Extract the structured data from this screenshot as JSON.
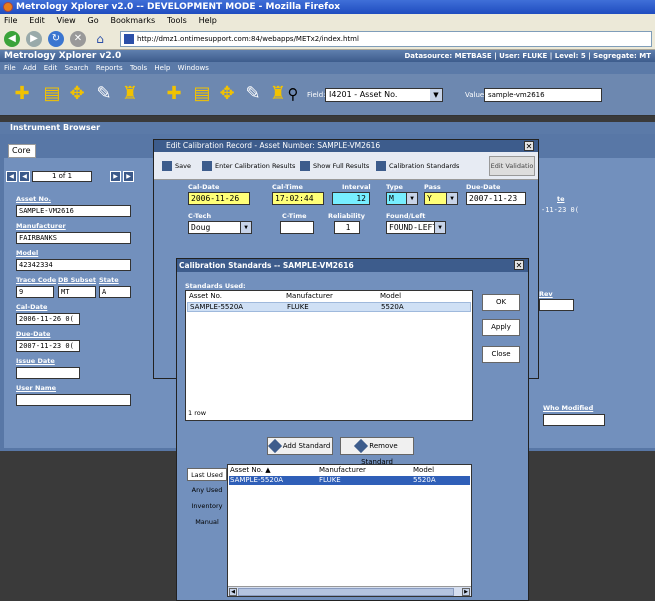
{
  "browser": {
    "title": "Metrology Xplorer v2.0 -- DEVELOPMENT MODE - Mozilla Firefox",
    "menu": [
      "File",
      "Edit",
      "View",
      "Go",
      "Bookmarks",
      "Tools",
      "Help"
    ],
    "url": "http://dmz1.ontimesupport.com:84/webapps/METx2/index.html"
  },
  "app": {
    "title": "Metrology Xplorer v2.0",
    "status": "Datasource: METBASE  |  User: FLUKE  |  Level: 5  |  Segregate: MT",
    "menu": [
      "File",
      "Add",
      "Edit",
      "Search",
      "Reports",
      "Tools",
      "Help",
      "Windows"
    ],
    "field_label": "Field:",
    "field_value": "I4201 - Asset No.",
    "value_label": "Value:",
    "value_value": "sample-vm2616"
  },
  "browser_panel": {
    "title": "Instrument Browser",
    "tab": "Core",
    "page": "1 of 1",
    "fields": {
      "asset_label": "Asset No.",
      "asset_value": "SAMPLE-VM2616",
      "mfr_label": "Manufacturer",
      "mfr_value": "FAIRBANKS",
      "model_label": "Model",
      "model_value": "42342334",
      "trace_label": "Trace Code",
      "trace_value": "9",
      "db_label": "DB Subset",
      "db_value": "MT",
      "state_label": "State",
      "state_value": "A",
      "cal_label": "Cal-Date",
      "cal_value": "2006-11-26 0(",
      "due_label": "Due-Date",
      "due_value": "2007-11-23 0(",
      "issue_label": "Issue Date",
      "issue_value": "",
      "user_label": "User Name",
      "user_value": "",
      "rev_label": "Rev",
      "date_right_label": "te",
      "date_right_value": "-11-23 0(",
      "who_label": "Who Modified"
    }
  },
  "edit_dialog": {
    "title": "Edit Calibration Record - Asset Number: SAMPLE-VM2616",
    "toolbar": {
      "save": "Save",
      "enter_results": "Enter Calibration Results",
      "show_full": "Show Full Results",
      "cal_standards": "Calibration Standards",
      "edit_validation": "Edit Validatio"
    },
    "fields": {
      "cal_date_label": "Cal-Date",
      "cal_date_value": "2006-11-26",
      "cal_time_label": "Cal-Time",
      "cal_time_value": "17:02:44",
      "interval_label": "Interval",
      "interval_value": "12",
      "type_label": "Type",
      "type_value": "M",
      "pass_label": "Pass",
      "pass_value": "Y",
      "due_date_label": "Due-Date",
      "due_date_value": "2007-11-23",
      "tech_label": "C-Tech",
      "tech_value": "Doug",
      "ctime_label": "C-Time",
      "ctime_value": "",
      "reliability_label": "Reliability",
      "reliability_value": "1",
      "found_left_label": "Found/Left",
      "found_left_value": "FOUND-LEFT"
    }
  },
  "std_dialog": {
    "title": "Calibration Standards -- SAMPLE-VM2616",
    "used_label": "Standards Used:",
    "columns": [
      "Asset No.",
      "Manufacturer",
      "Model"
    ],
    "used_rows": [
      [
        "SAMPLE-5520A",
        "FLUKE",
        "5520A"
      ]
    ],
    "row_count": "1 row",
    "buttons": {
      "ok": "OK",
      "apply": "Apply",
      "close": "Close"
    },
    "add_standard": "Add Standard",
    "remove_standard": "Remove Standard",
    "side_tabs": [
      "Last Used",
      "Any Used",
      "Inventory",
      "Manual"
    ],
    "lookup_columns": [
      "Asset No. ▲",
      "Manufacturer",
      "Model"
    ],
    "lookup_rows": [
      [
        "SAMPLE-5520A",
        "FLUKE",
        "5520A"
      ]
    ]
  }
}
